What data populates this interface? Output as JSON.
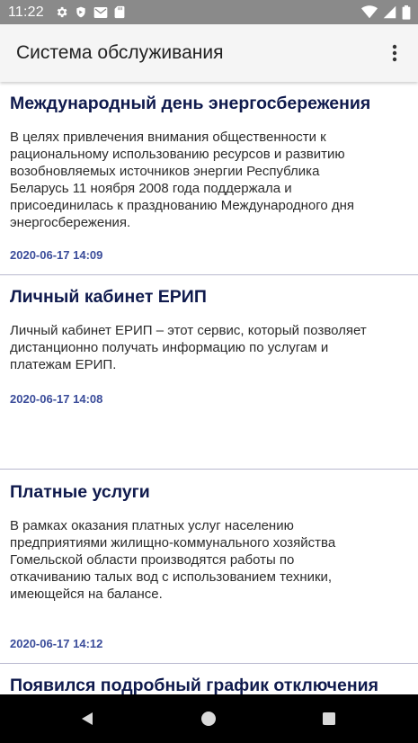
{
  "status_bar": {
    "time": "11:22",
    "icons_left": [
      "gear-icon",
      "shield-icon",
      "mail-icon",
      "sdcard-icon"
    ],
    "icons_right": [
      "wifi-icon",
      "signal-icon",
      "battery-icon"
    ]
  },
  "app_bar": {
    "title": "Система обслуживания",
    "overflow_icon": "more-vertical-icon"
  },
  "news": [
    {
      "title": "Международный день энергосбережения",
      "text": "В целях привлечения внимания общественности к\nрациональному использованию ресурсов и развитию\nвозобновляемых источников энергии Республика\nБеларусь 11 ноября 2008 года поддержала и\nприсоединилась к празднованию Международного дня\nэнергосбережения.",
      "date": "2020-06-17 14:09"
    },
    {
      "title": "Личный кабинет ЕРИП",
      "text": "Личный кабинет ЕРИП – этот сервис, который позволяет\nдистанционно получать информацию по услугам и\nплатежам ЕРИП.",
      "date": "2020-06-17 14:08"
    },
    {
      "title": "Платные услуги",
      "text": "В рамках оказания платных услуг населению\nпредприятиями  жилищно-коммунального хозяйства\nГомельской области производятся работы по\nоткачиванию талых вод с использованием техники,\nимеющейся на балансе.",
      "date": "2020-06-17 14:12"
    },
    {
      "title": "Появился подробный график отключения"
    }
  ],
  "nav_bar": {
    "icons": [
      "back-icon",
      "home-icon",
      "recents-icon"
    ]
  },
  "colors": {
    "status_bar": "#8a8a8a",
    "app_bar": "#f5f5f5",
    "title_text": "#0f1a4d",
    "date_text": "#3a4c9a",
    "divider": "#b9b9cf"
  }
}
